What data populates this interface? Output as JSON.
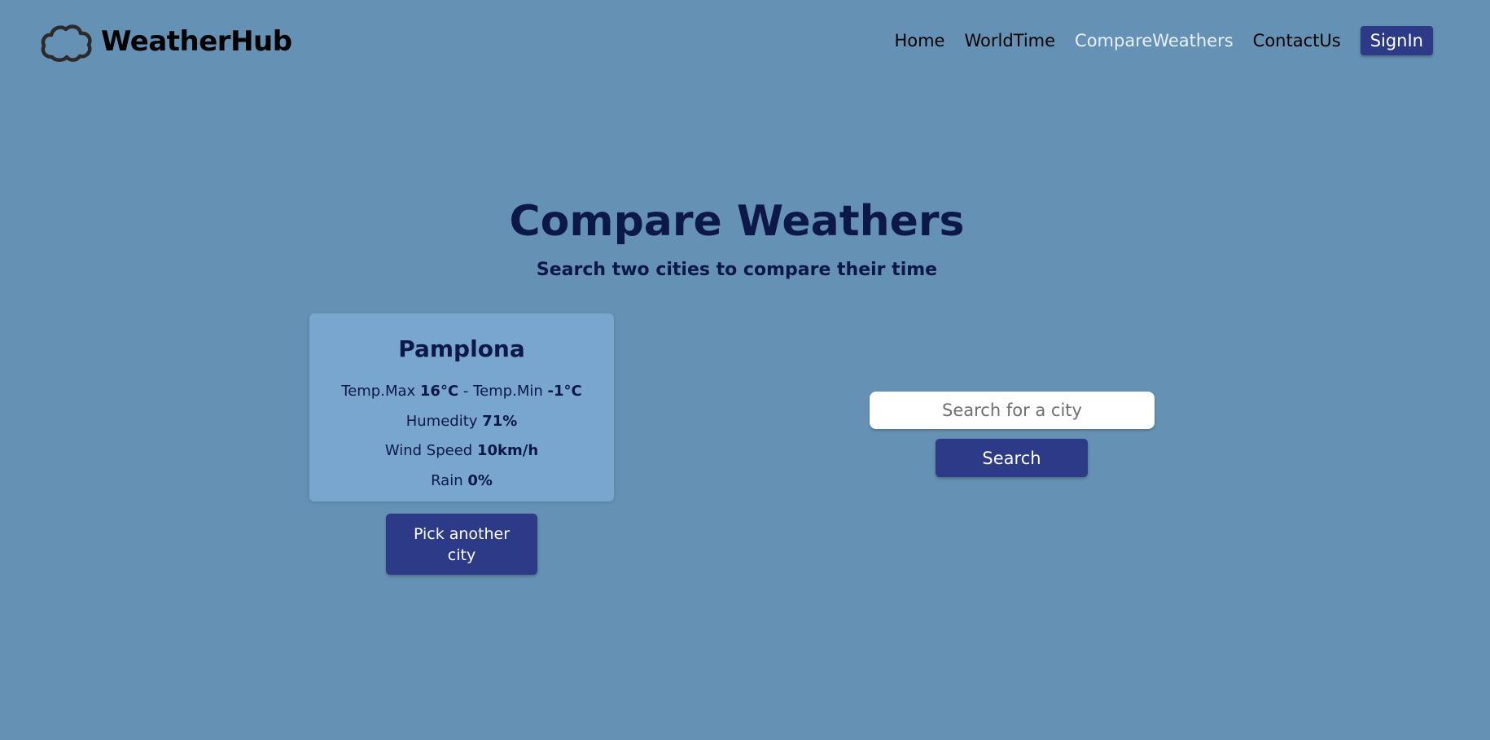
{
  "brand": {
    "name": "WeatherHub",
    "icon": "cloud-icon"
  },
  "nav": {
    "items": [
      {
        "label": "Home"
      },
      {
        "label": "WorldTime"
      },
      {
        "label": "CompareWeathers",
        "active": true
      },
      {
        "label": "ContactUs"
      }
    ],
    "signin_label": "SignIn"
  },
  "page": {
    "title": "Compare Weathers",
    "subtitle": "Search two cities to compare their time"
  },
  "city_card": {
    "city": "Pamplona",
    "temp_max_label": "Temp.Max",
    "temp_max": "16°C",
    "separator": "-",
    "temp_min_label": "Temp.Min",
    "temp_min": "-1°C",
    "humidity_label": "Humedity",
    "humidity": "71%",
    "wind_label": "Wind Speed",
    "wind": "10km/h",
    "rain_label": "Rain",
    "rain": "0%",
    "pick_another_label": "Pick another city"
  },
  "search": {
    "placeholder": "Search for a city",
    "value": "",
    "button_label": "Search"
  },
  "colors": {
    "background": "#6591b4",
    "card": "#79a6cf",
    "accent": "#2d3a85",
    "heading": "#0c1848",
    "active_nav": "#e8f1fb"
  }
}
